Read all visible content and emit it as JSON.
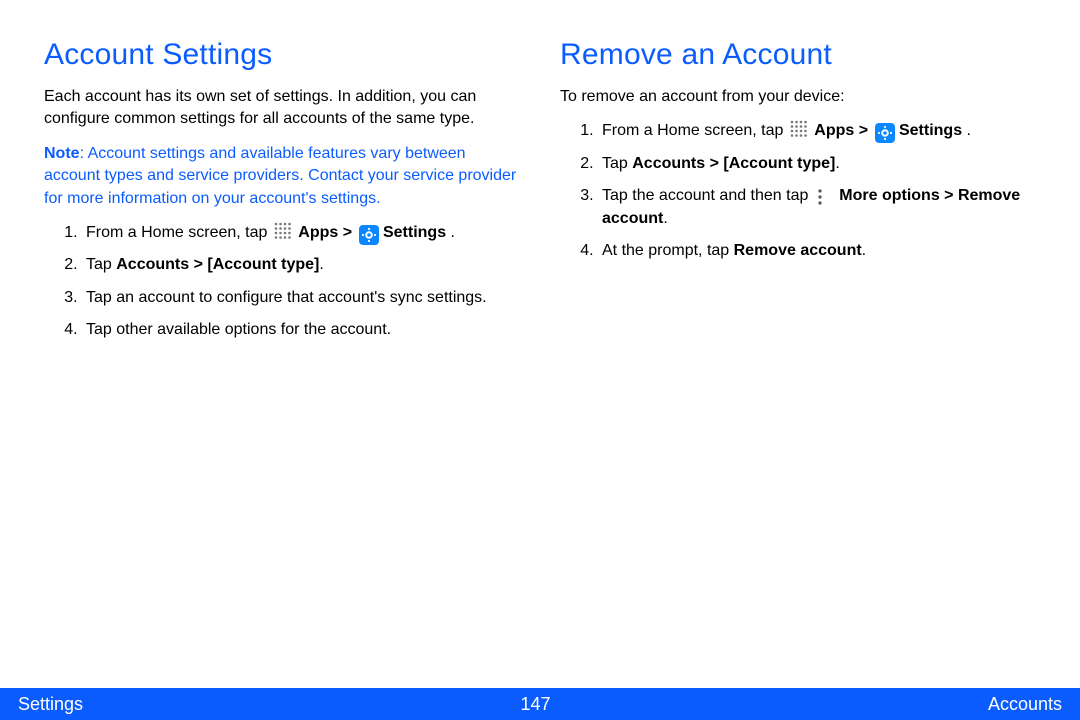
{
  "left": {
    "heading": "Account Settings",
    "intro": "Each account has its own set of settings. In addition, you can configure common settings for all accounts of the same type.",
    "note_label": "Note",
    "note_body": ": Account settings and available features vary between account types and service providers. Contact your service provider for more information on your account's settings.",
    "step1_pre": "From a Home screen, tap ",
    "step1_apps": "Apps > ",
    "step1_settings": "Settings ",
    "step1_post": ".",
    "step2_pre": "Tap ",
    "step2_bold": "Accounts > [Account type]",
    "step2_post": ".",
    "step3": "Tap an account to configure that account's sync settings.",
    "step4": "Tap other available options for the account."
  },
  "right": {
    "heading": "Remove an Account",
    "intro": "To remove an account from your device:",
    "step1_pre": "From a Home screen, tap ",
    "step1_apps": "Apps > ",
    "step1_settings": "Settings ",
    "step1_post": ".",
    "step2_pre": "Tap ",
    "step2_bold": "Accounts > [Account type]",
    "step2_post": ".",
    "step3_pre": "Tap the account and then tap ",
    "step3_bold": "More options > Remove account",
    "step3_post": ".",
    "step4_pre": "At the prompt, tap ",
    "step4_bold": "Remove account",
    "step4_post": "."
  },
  "footer": {
    "left": "Settings",
    "center": "147",
    "right": "Accounts"
  }
}
